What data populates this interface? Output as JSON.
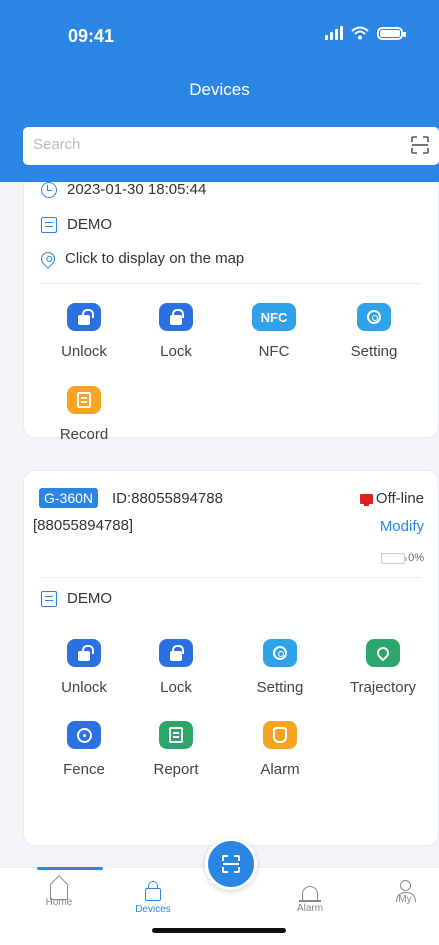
{
  "status_bar": {
    "time": "09:41"
  },
  "header": {
    "title": "Devices"
  },
  "search": {
    "placeholder": "Search"
  },
  "device1": {
    "datetime": "2023-01-30 18:05:44",
    "group": "DEMO",
    "map_text": "Click to display on the map",
    "actions": [
      {
        "label": "Unlock",
        "icon": "unlock-icon",
        "color": "#2c71df"
      },
      {
        "label": "Lock",
        "icon": "lock-icon",
        "color": "#2c71df"
      },
      {
        "label": "NFC",
        "icon": "nfc-icon",
        "color": "#30a3e8"
      },
      {
        "label": "Setting",
        "icon": "gear-icon",
        "color": "#30a3e8"
      },
      {
        "label": "Record",
        "icon": "record-icon",
        "color": "#f5a523"
      }
    ]
  },
  "device2": {
    "model": "G-360N",
    "id": "ID:88055894788",
    "status": "Off-line",
    "code": "[88055894788]",
    "modify": "Modify",
    "battery": "0%",
    "group": "DEMO",
    "actions": [
      {
        "label": "Unlock",
        "icon": "unlock-icon",
        "color": "#2c71df"
      },
      {
        "label": "Lock",
        "icon": "lock-icon",
        "color": "#2c71df"
      },
      {
        "label": "Setting",
        "icon": "gear-icon",
        "color": "#30a3e8"
      },
      {
        "label": "Trajectory",
        "icon": "trajectory-icon",
        "color": "#2ea56a"
      },
      {
        "label": "Fence",
        "icon": "fence-icon",
        "color": "#2c71df"
      },
      {
        "label": "Report",
        "icon": "report-icon",
        "color": "#2ea56a"
      },
      {
        "label": "Alarm",
        "icon": "alarm-icon",
        "color": "#f5a523"
      }
    ]
  },
  "nfc_text": "NFC",
  "tabbar": {
    "home": "Home",
    "devices": "Devices",
    "alarm": "Alarm",
    "my": "My"
  }
}
